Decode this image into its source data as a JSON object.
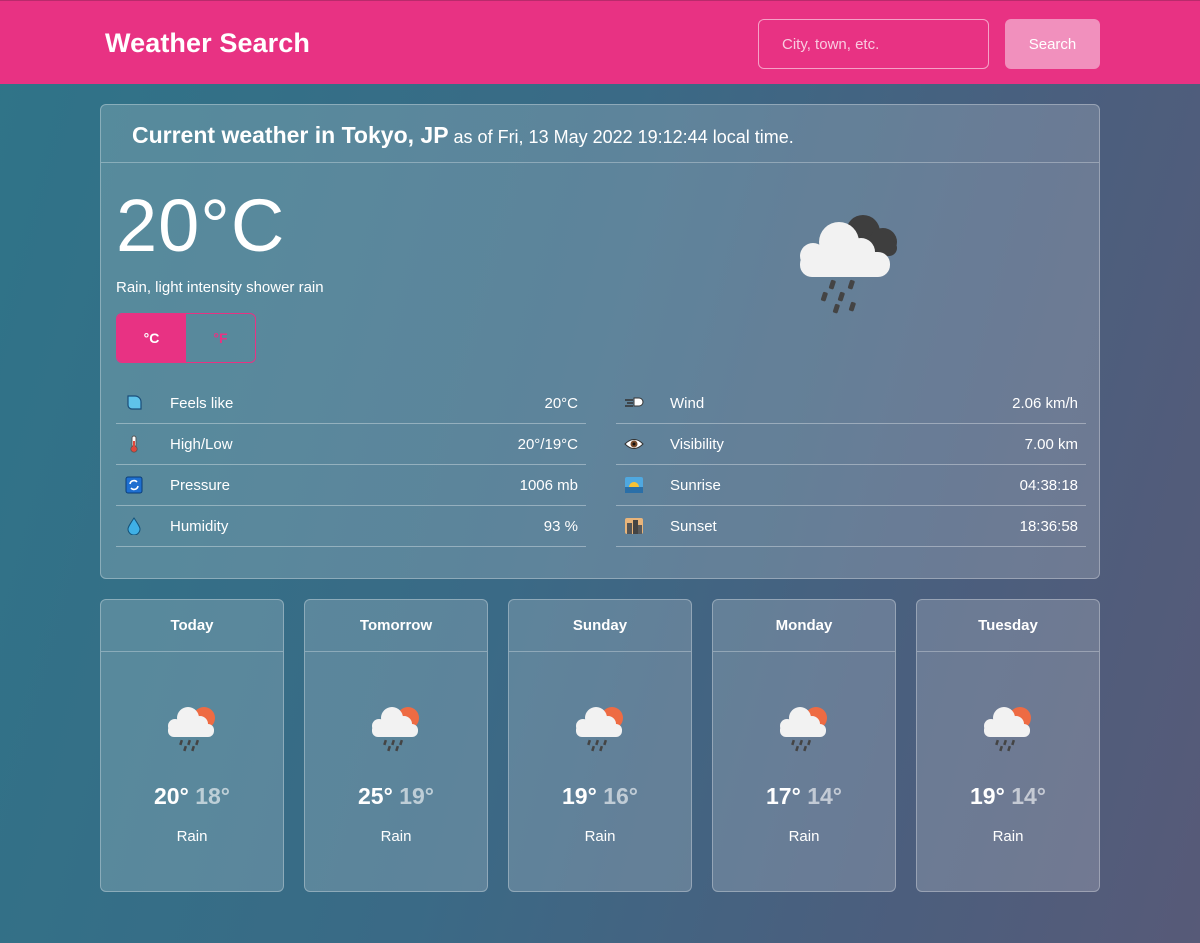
{
  "header": {
    "brand": "Weather Search",
    "search_placeholder": "City, town, etc.",
    "search_label": "Search",
    "accent_color": "#e83283"
  },
  "current": {
    "title_location": "Current weather in Tokyo, JP",
    "title_suffix": "as of Fri, 13 May 2022 19:12:44 local time.",
    "temperature": "20°C",
    "description": "Rain, light intensity shower rain",
    "weather_icon": "rain-cloud-icon",
    "unit_celsius": "°C",
    "unit_fahrenheit": "°F",
    "active_unit": "°C",
    "stats_left": [
      {
        "label": "Feels like",
        "value": "20°C",
        "icon": "feels-like-icon"
      },
      {
        "label": "High/Low",
        "value": "20°/19°C",
        "icon": "thermometer-icon"
      },
      {
        "label": "Pressure",
        "value": "1006 mb",
        "icon": "pressure-icon"
      },
      {
        "label": "Humidity",
        "value": "93 %",
        "icon": "droplet-icon"
      }
    ],
    "stats_right": [
      {
        "label": "Wind",
        "value": "2.06 km/h",
        "icon": "wind-icon"
      },
      {
        "label": "Visibility",
        "value": "7.00 km",
        "icon": "eye-icon"
      },
      {
        "label": "Sunrise",
        "value": "04:38:18",
        "icon": "sunrise-icon"
      },
      {
        "label": "Sunset",
        "value": "18:36:58",
        "icon": "sunset-icon"
      }
    ]
  },
  "forecast": [
    {
      "day": "Today",
      "high": "20°",
      "low": "18°",
      "condition": "Rain",
      "icon": "sun-rain-cloud-icon"
    },
    {
      "day": "Tomorrow",
      "high": "25°",
      "low": "19°",
      "condition": "Rain",
      "icon": "sun-rain-cloud-icon"
    },
    {
      "day": "Sunday",
      "high": "19°",
      "low": "16°",
      "condition": "Rain",
      "icon": "sun-rain-cloud-icon"
    },
    {
      "day": "Monday",
      "high": "17°",
      "low": "14°",
      "condition": "Rain",
      "icon": "sun-rain-cloud-icon"
    },
    {
      "day": "Tuesday",
      "high": "19°",
      "low": "14°",
      "condition": "Rain",
      "icon": "sun-rain-cloud-icon"
    }
  ]
}
